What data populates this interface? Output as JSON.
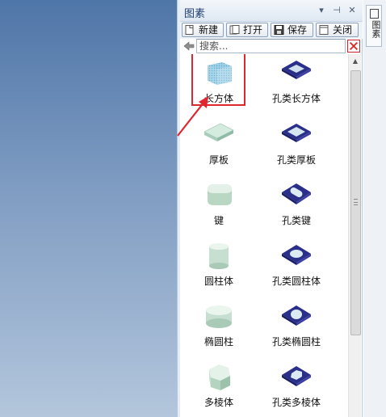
{
  "panel": {
    "title": "图素",
    "controls": {
      "pin": "▾",
      "autohide": "⊣",
      "close": "✕"
    }
  },
  "toolbar": {
    "new_label": "新建",
    "open_label": "打开",
    "save_label": "保存",
    "close_label": "关闭"
  },
  "search": {
    "placeholder": "搜索...",
    "value": ""
  },
  "gallery": {
    "items": [
      {
        "label": "长方体",
        "icon": "cuboid-icon"
      },
      {
        "label": "孔类长方体",
        "icon": "hole-cuboid-icon"
      },
      {
        "label": "厚板",
        "icon": "thick-plate-icon"
      },
      {
        "label": "孔类厚板",
        "icon": "hole-thick-plate-icon"
      },
      {
        "label": "键",
        "icon": "key-icon"
      },
      {
        "label": "孔类键",
        "icon": "hole-key-icon"
      },
      {
        "label": "圆柱体",
        "icon": "cylinder-icon"
      },
      {
        "label": "孔类圆柱体",
        "icon": "hole-cylinder-icon"
      },
      {
        "label": "椭圆柱",
        "icon": "elliptic-cylinder-icon"
      },
      {
        "label": "孔类椭圆柱",
        "icon": "hole-elliptic-cylinder-icon"
      },
      {
        "label": "多棱体",
        "icon": "polyprism-icon"
      },
      {
        "label": "孔类多棱体",
        "icon": "hole-polyprism-icon"
      }
    ],
    "selected_index": 0
  },
  "side_tab": {
    "label": "图素"
  },
  "colors": {
    "highlight": "#e0262e",
    "viewport_top": "#4f76a8",
    "viewport_bottom": "#b3c6dc",
    "hole_blue": "#2a2f8a"
  }
}
